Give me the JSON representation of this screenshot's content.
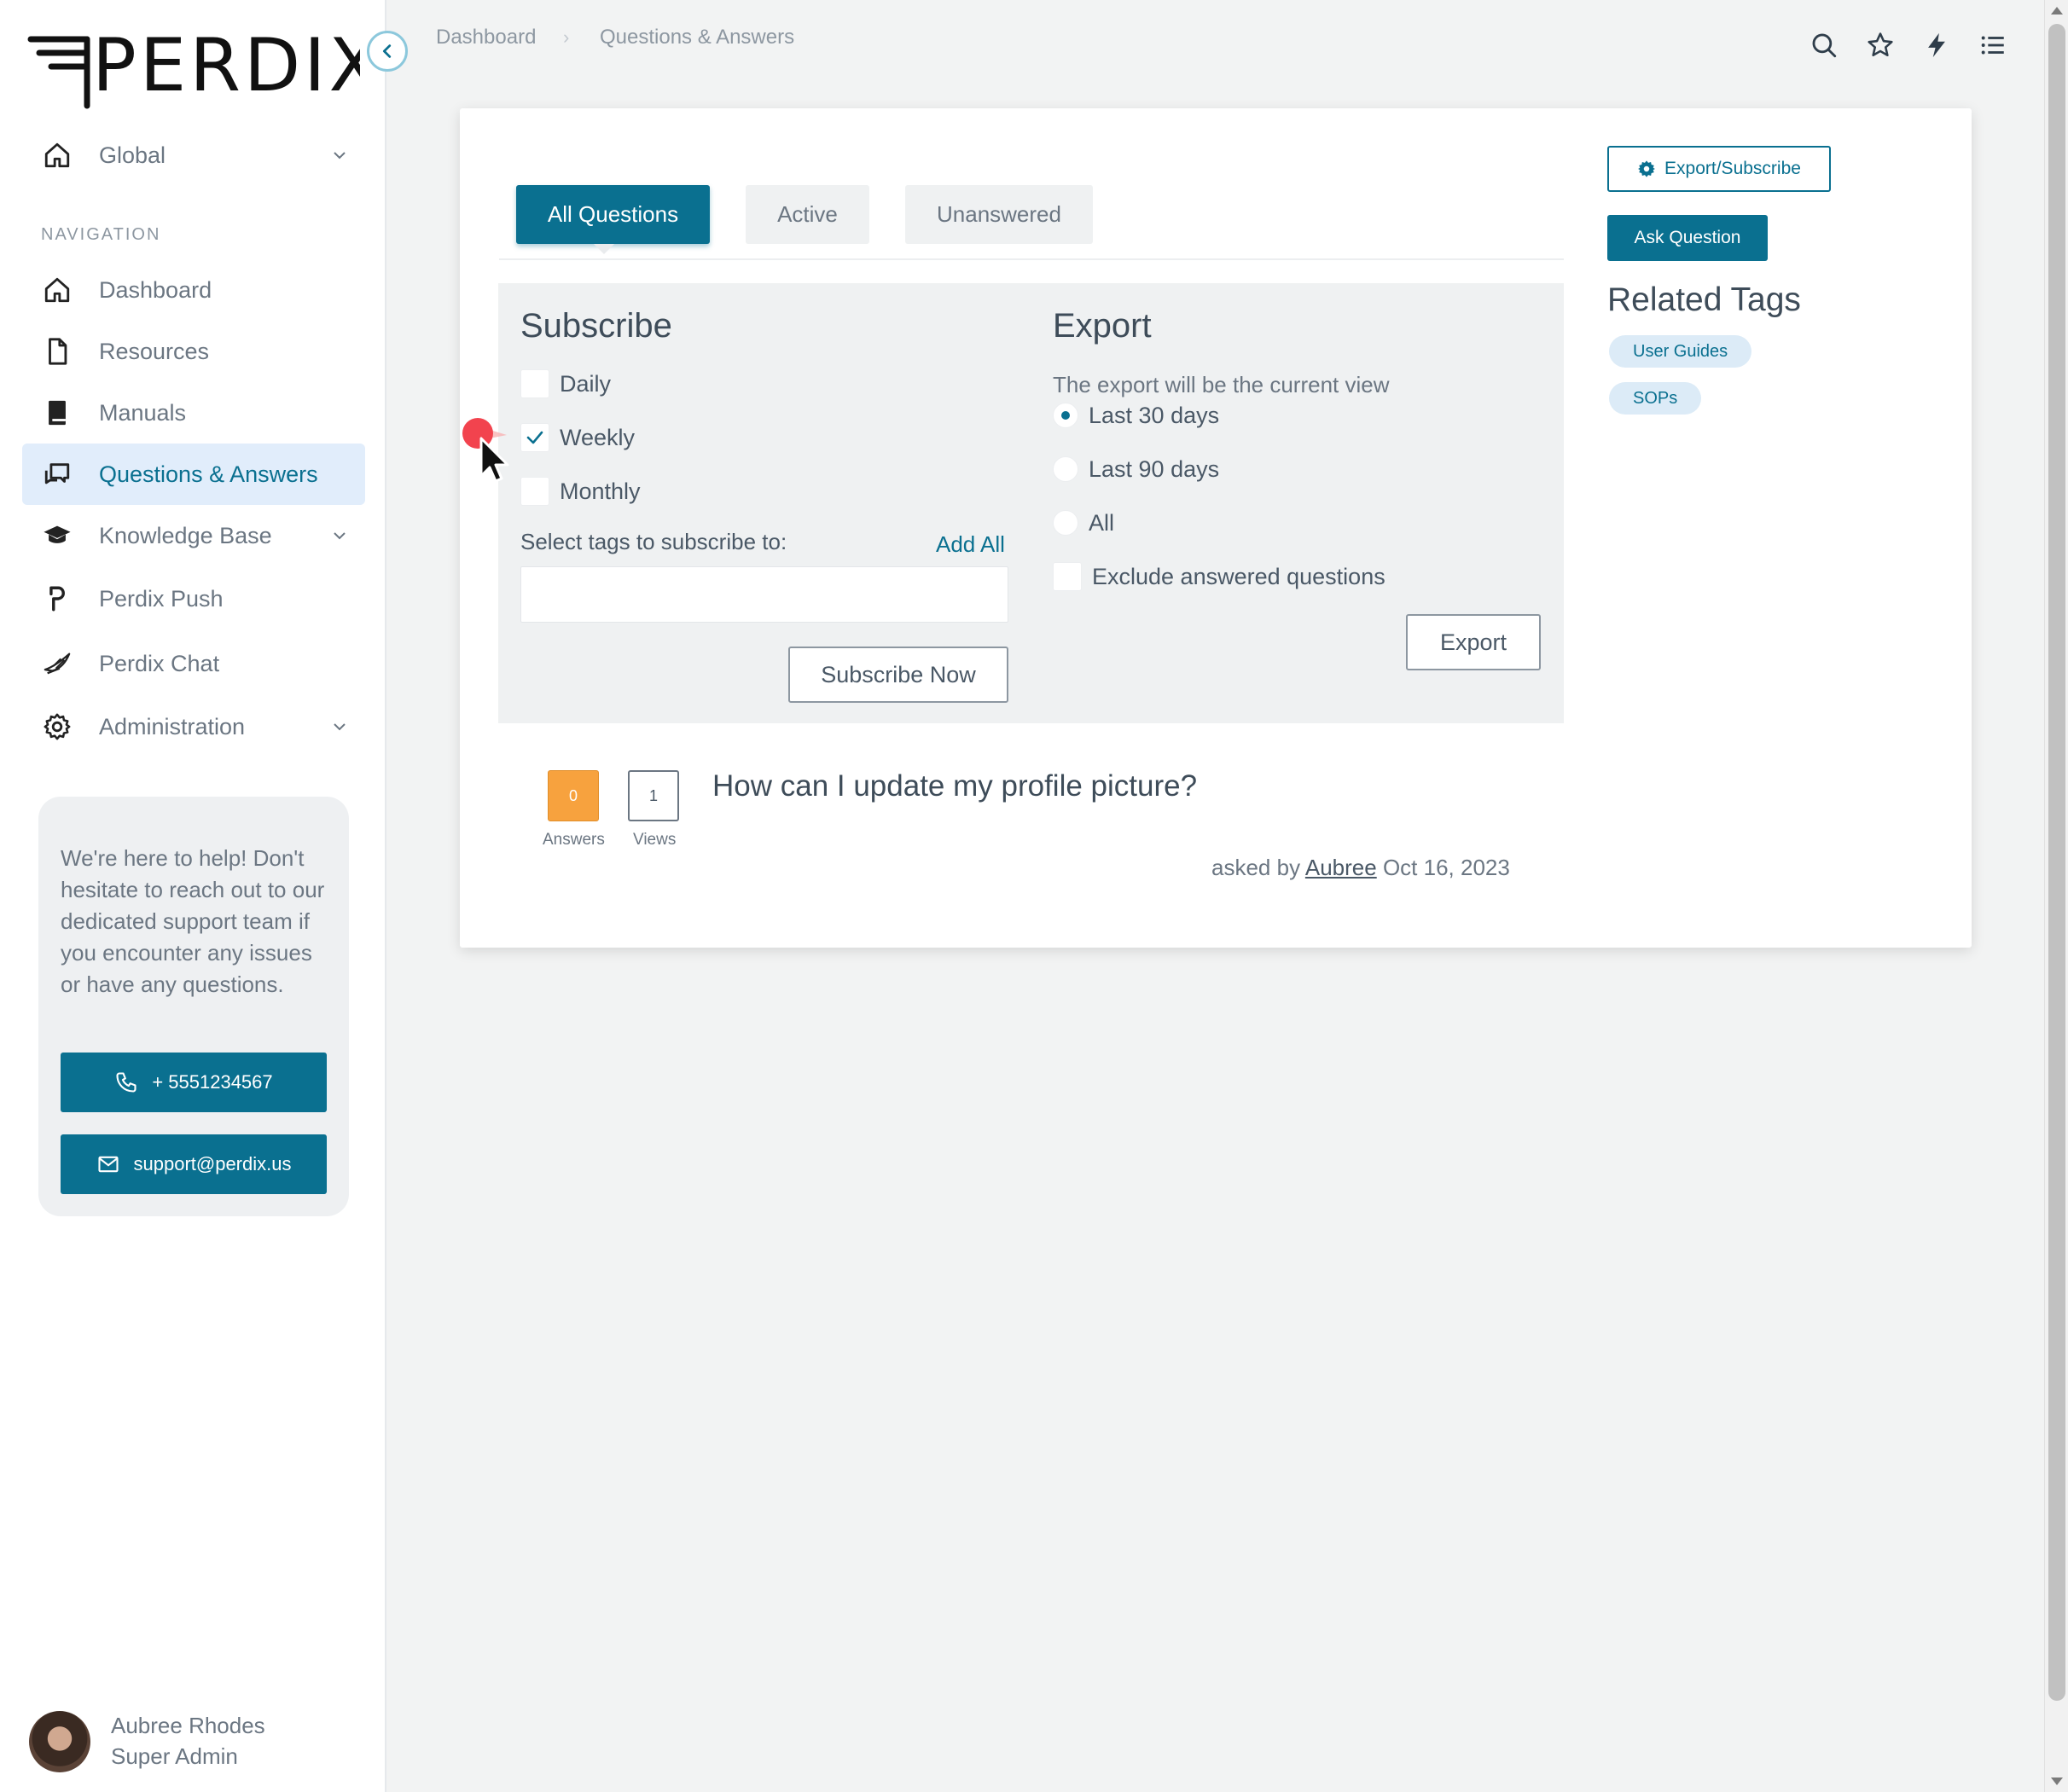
{
  "brand": {
    "logo_text": "PERDIX"
  },
  "sidebar": {
    "global_label": "Global",
    "section_label": "NAVIGATION",
    "items": [
      {
        "label": "Dashboard",
        "icon": "home-icon"
      },
      {
        "label": "Resources",
        "icon": "file-icon"
      },
      {
        "label": "Manuals",
        "icon": "book-icon"
      },
      {
        "label": "Questions & Answers",
        "icon": "chat-icon",
        "active": true
      },
      {
        "label": "Knowledge Base",
        "icon": "graduation-cap-icon"
      },
      {
        "label": "Perdix Push",
        "icon": "perdix-push-icon"
      },
      {
        "label": "Perdix Chat",
        "icon": "bird-icon"
      },
      {
        "label": "Administration",
        "icon": "gear-icon"
      }
    ],
    "help": {
      "text": "We're here to help! Don't hesitate to reach out to our dedicated support team if you encounter any issues or have any questions.",
      "phone": "+ 5551234567",
      "email": "support@perdix.us"
    },
    "user": {
      "name": "Aubree Rhodes",
      "role": "Super Admin"
    }
  },
  "breadcrumb": {
    "root": "Dashboard",
    "sep": "›",
    "current": "Questions & Answers"
  },
  "tabs": [
    "All Questions",
    "Active",
    "Unanswered"
  ],
  "subscribe": {
    "title": "Subscribe",
    "options": [
      {
        "label": "Daily",
        "checked": false
      },
      {
        "label": "Weekly",
        "checked": true
      },
      {
        "label": "Monthly",
        "checked": false
      }
    ],
    "tags_label": "Select tags to subscribe to:",
    "add_all": "Add All",
    "tags_input_value": "",
    "button": "Subscribe Now"
  },
  "export": {
    "title": "Export",
    "description": "The export will be the current view",
    "ranges": [
      {
        "label": "Last 30 days",
        "selected": true
      },
      {
        "label": "Last 90 days",
        "selected": false
      },
      {
        "label": "All",
        "selected": false
      }
    ],
    "exclude_label": "Exclude answered questions",
    "button": "Export"
  },
  "question": {
    "answers": "0",
    "answers_label": "Answers",
    "views": "1",
    "views_label": "Views",
    "title": "How can I update my profile picture?",
    "asked_prefix": "asked by",
    "author": "Aubree",
    "date": "Oct 16, 2023"
  },
  "actions": {
    "export_subscribe": "Export/Subscribe",
    "ask_question": "Ask Question"
  },
  "related": {
    "title": "Related Tags",
    "tags": [
      "User Guides",
      "SOPs"
    ]
  },
  "colors": {
    "primary": "#0a7090",
    "answers_badge": "#f7a23e",
    "active_nav_bg": "#e1edfb"
  }
}
